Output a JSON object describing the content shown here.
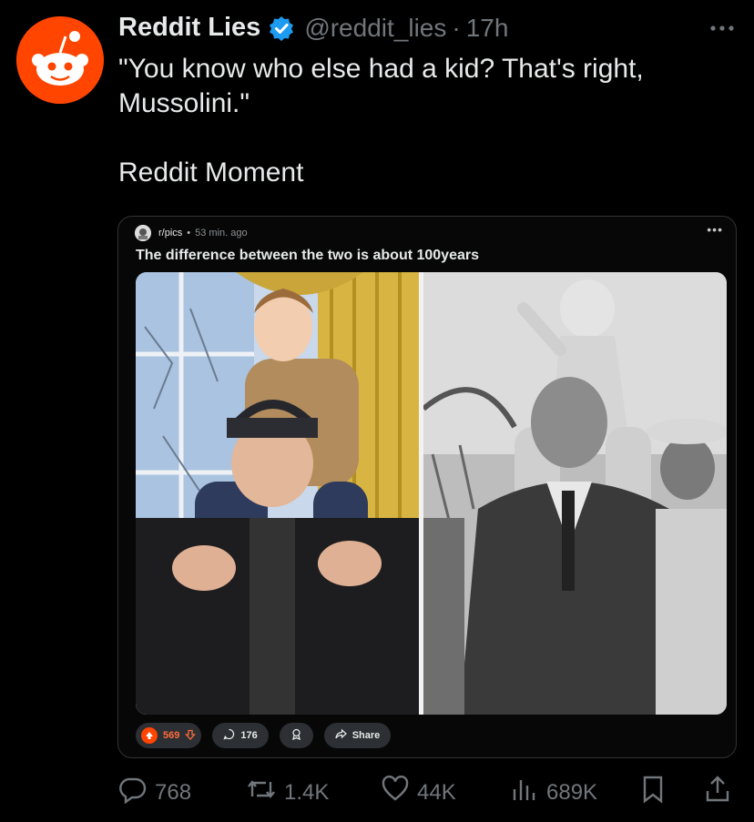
{
  "author": {
    "name": "Reddit Lies",
    "handle": "@reddit_lies",
    "separator": "·",
    "time": "17h"
  },
  "tweet": {
    "text": "\"You know who else had a kid? That's right,\nMussolini.\"\n\nReddit Moment"
  },
  "card": {
    "subreddit": "r/pics",
    "separator": "•",
    "age": "53 min. ago",
    "title": "The difference between the two is about 100years",
    "votes": "569",
    "comments": "176",
    "share_label": "Share"
  },
  "actions": {
    "replies": "768",
    "reposts": "1.4K",
    "likes": "44K",
    "views": "689K"
  },
  "colors": {
    "accent": "#ff4500",
    "verified": "#1d9bf0",
    "muted": "#71767b"
  },
  "icons": [
    "reddit-logo-icon",
    "verified-badge-icon",
    "more-options-icon",
    "upvote-icon",
    "downvote-icon",
    "comment-icon",
    "award-icon",
    "share-icon",
    "reply-icon",
    "repost-icon",
    "like-icon",
    "views-icon",
    "bookmark-icon",
    "upload-share-icon"
  ]
}
